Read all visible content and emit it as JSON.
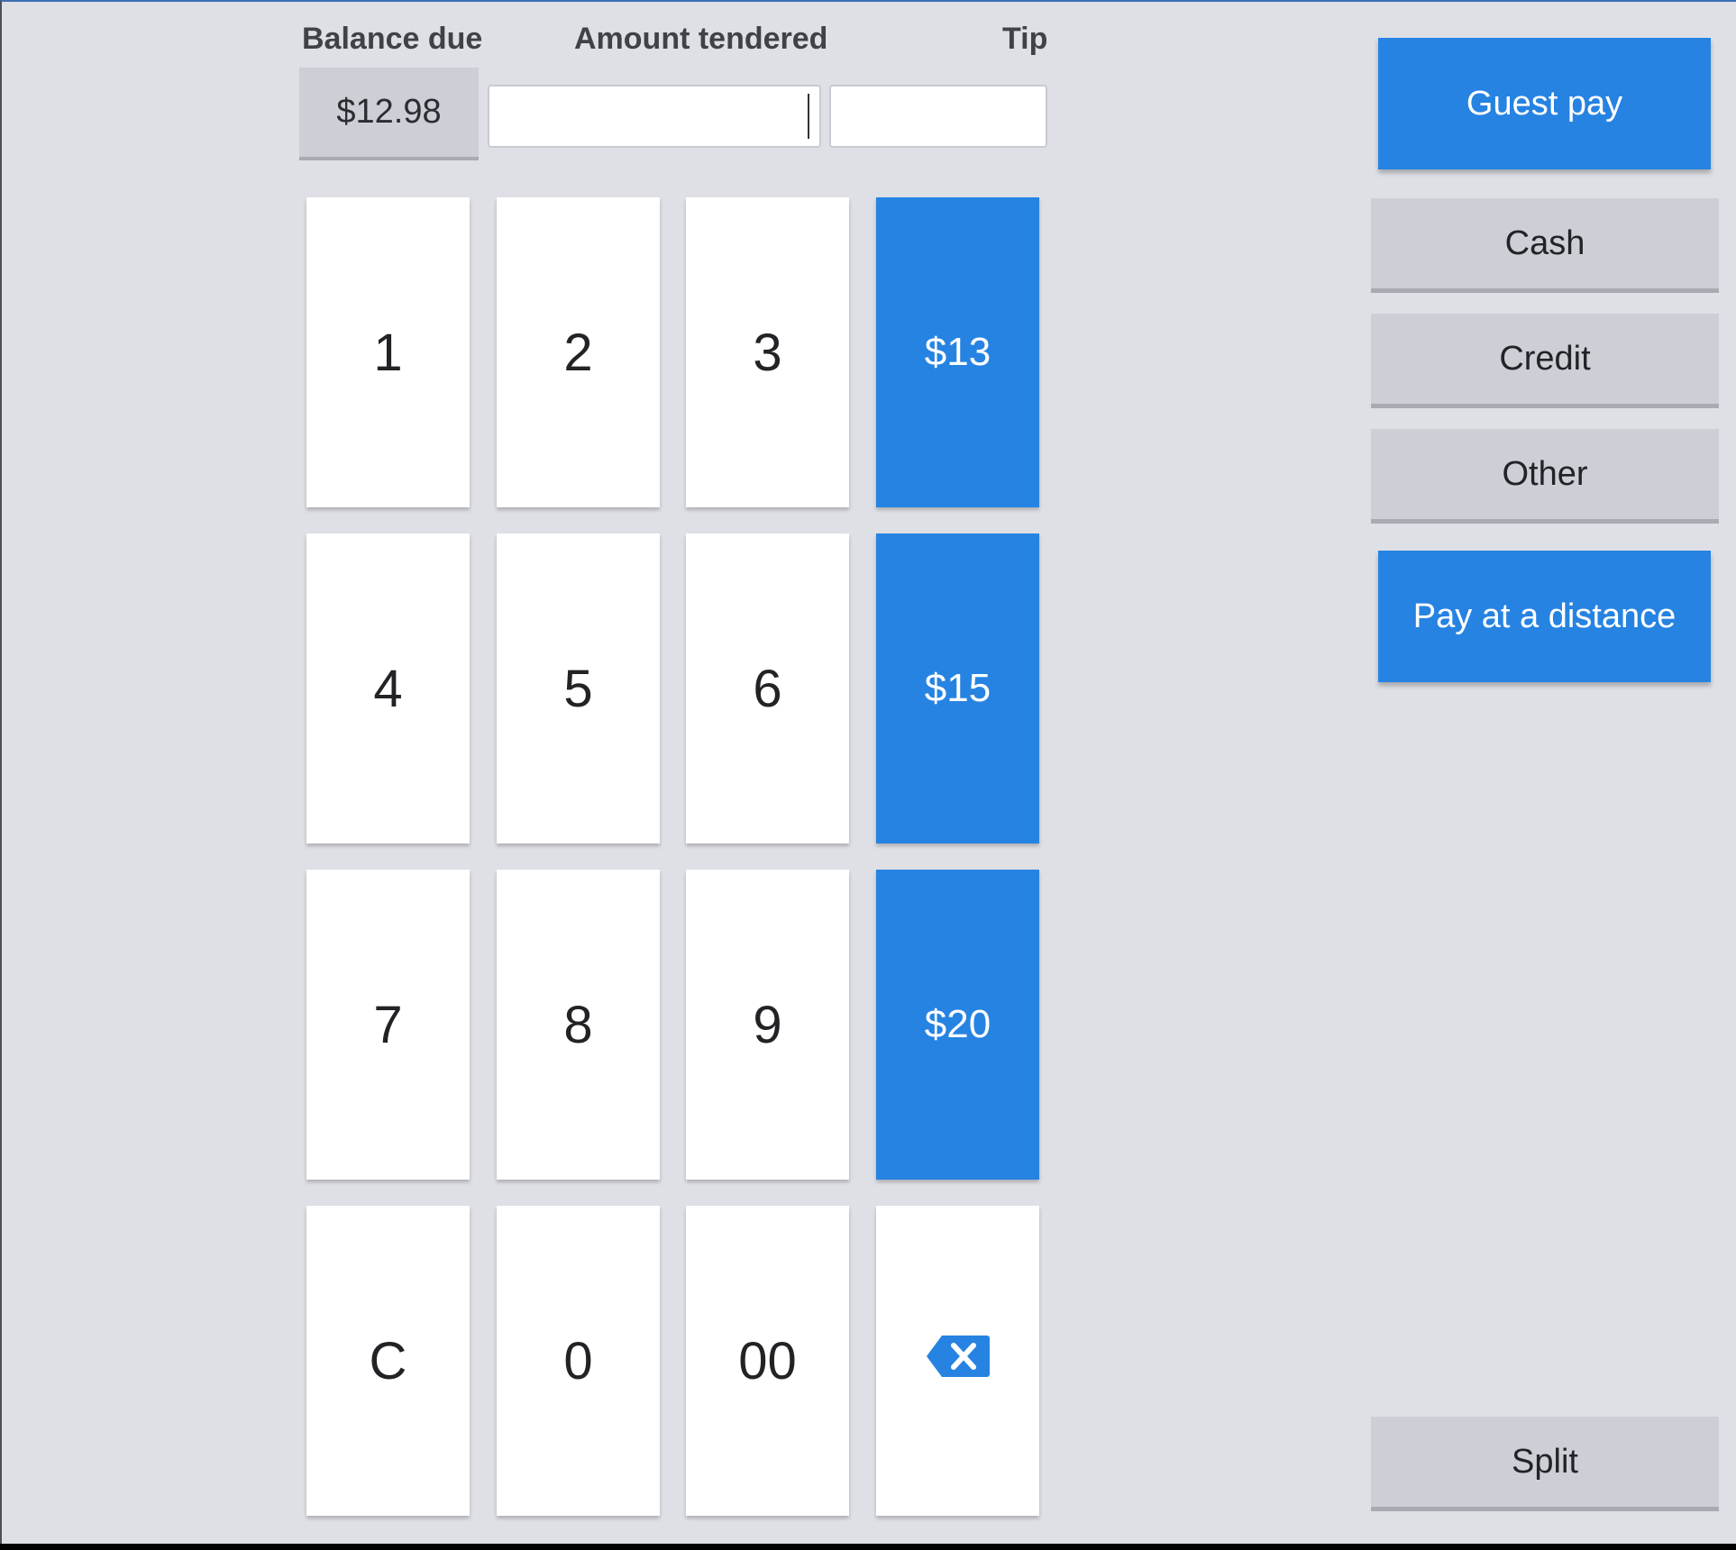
{
  "header": {
    "balance_label": "Balance due",
    "tendered_label": "Amount tendered",
    "tip_label": "Tip"
  },
  "balance": {
    "value": "$12.98"
  },
  "tendered_input": {
    "value": "",
    "placeholder": ""
  },
  "tip_input": {
    "value": "",
    "placeholder": ""
  },
  "keypad": {
    "k1": "1",
    "k2": "2",
    "k3": "3",
    "k4": "4",
    "k5": "5",
    "k6": "6",
    "k7": "7",
    "k8": "8",
    "k9": "9",
    "clear": "C",
    "k0": "0",
    "k00": "00",
    "quick1": "$13",
    "quick2": "$15",
    "quick3": "$20",
    "backspace_icon": "backspace-icon"
  },
  "payment_options": {
    "guest_pay": "Guest pay",
    "cash": "Cash",
    "credit": "Credit",
    "other": "Other",
    "pay_at_distance": "Pay at a distance",
    "split": "Split"
  },
  "colors": {
    "accent": "#2683e2",
    "background": "#dfe0e6",
    "secondary_button": "#cdced6"
  }
}
